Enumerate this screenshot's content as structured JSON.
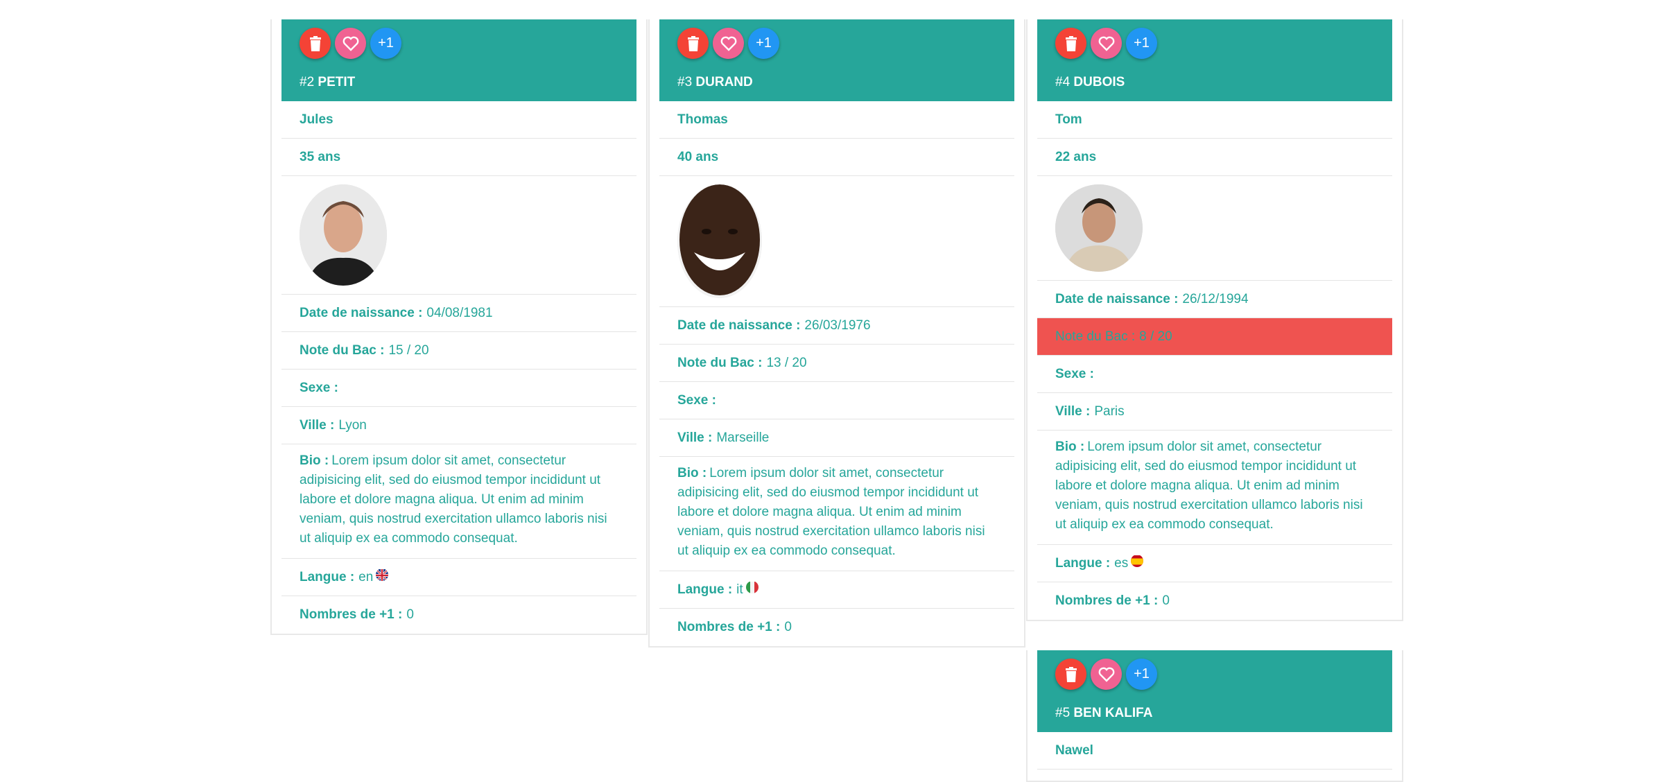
{
  "labels": {
    "plus_one": "+1",
    "birth": "Date de naissance :",
    "bac": "Note du Bac :",
    "sex": "Sexe :",
    "city": "Ville :",
    "bio": "Bio :",
    "lang": "Langue :",
    "plus_count": "Nombres de +1 :"
  },
  "cards": [
    {
      "num": "#2",
      "last": "PETIT",
      "first": "Jules",
      "age": "35 ans",
      "birth": "04/08/1981",
      "bac": "15 / 20",
      "sex": "",
      "city": "Lyon",
      "bio": "Lorem ipsum dolor sit amet, consectetur adipisicing elit, sed do eiusmod tempor incididunt ut labore et dolore magna aliqua. Ut enim ad minim veniam, quis nostrud exercitation ullamco laboris nisi ut aliquip ex ea commodo consequat.",
      "lang": "en",
      "plus_count": "0",
      "flag": "uk-flag-icon"
    },
    {
      "num": "#3",
      "last": "DURAND",
      "first": "Thomas",
      "age": "40 ans",
      "birth": "26/03/1976",
      "bac": "13 / 20",
      "sex": "",
      "city": "Marseille",
      "bio": "Lorem ipsum dolor sit amet, consectetur adipisicing elit, sed do eiusmod tempor incididunt ut labore et dolore magna aliqua. Ut enim ad minim veniam, quis nostrud exercitation ullamco laboris nisi ut aliquip ex ea commodo consequat.",
      "lang": "it",
      "plus_count": "0",
      "flag": "italy-flag-icon"
    },
    {
      "num": "#4",
      "last": "DUBOIS",
      "first": "Tom",
      "age": "22 ans",
      "birth": "26/12/1994",
      "bac": "8 / 20",
      "sex": "",
      "city": "Paris",
      "bio": "Lorem ipsum dolor sit amet, consectetur adipisicing elit, sed do eiusmod tempor incididunt ut labore et dolore magna aliqua. Ut enim ad minim veniam, quis nostrud exercitation ullamco laboris nisi ut aliquip ex ea commodo consequat.",
      "lang": "es",
      "plus_count": "0",
      "flag": "spain-flag-icon"
    },
    {
      "num": "#5",
      "last": "BEN KALIFA",
      "first": "Nawel"
    }
  ],
  "colors": {
    "teal": "#26a69a",
    "delete": "#f44336",
    "like": "#f06292",
    "plus": "#2196f3",
    "failing_grade": "#ef5350"
  }
}
